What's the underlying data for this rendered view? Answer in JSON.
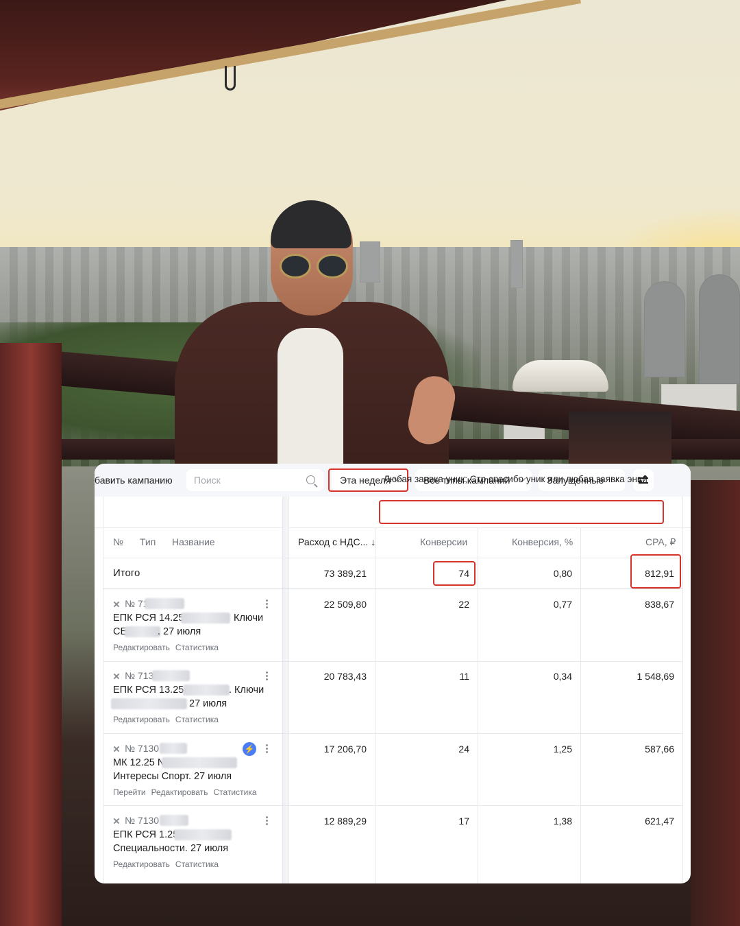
{
  "toolbar": {
    "add_campaign": "бавить кампанию",
    "search_placeholder": "Поиск",
    "period": "Эта неделя",
    "campaign_types": "Все типы кампаний",
    "status_filter": "Запущенные"
  },
  "goal_filter": "Любая заявка уник; Стр спасибо уник или любая заявка энви",
  "columns": {
    "number": "№",
    "type": "Тип",
    "name": "Название",
    "spend": "Расход с НДС... ↓",
    "conversions": "Конверсии",
    "conversion_rate": "Конверсия, %",
    "cpa": "CPA, ₽"
  },
  "totals": {
    "label": "Итого",
    "spend": "73 389,21",
    "conversions": "74",
    "conversion_rate": "0,80",
    "cpa": "812,91"
  },
  "campaigns": [
    {
      "id": "№ 71",
      "line1": "ЕПК РСЯ 14.25",
      "line1_tail": "Ключи",
      "line2_head": "СЕ",
      "line2_tail": ". 27 июля",
      "actions": [
        "Редактировать",
        "Статистика"
      ],
      "spend": "22 509,80",
      "conversions": "22",
      "conversion_rate": "0,77",
      "cpa": "838,67"
    },
    {
      "id": "№ 713",
      "line1": "ЕПК РСЯ 13.25 І",
      "line1_tail": ". Ключи",
      "line2_tail": "27 июля",
      "actions": [
        "Редактировать",
        "Статистика"
      ],
      "spend": "20 783,43",
      "conversions": "11",
      "conversion_rate": "0,34",
      "cpa": "1 548,69"
    },
    {
      "id": "№ 7130",
      "line1": "МК 12.25 N",
      "line2": "Интересы Спорт. 27 июля",
      "actions": [
        "Перейти",
        "Редактировать",
        "Статистика"
      ],
      "spend": "17 206,70",
      "conversions": "24",
      "conversion_rate": "1,25",
      "cpa": "587,66"
    },
    {
      "id": "№ 7130",
      "line1": "ЕПК РСЯ 1.25",
      "line2": "Специальности. 27 июля",
      "actions": [
        "Редактировать",
        "Статистика"
      ],
      "spend": "12 889,29",
      "conversions": "17",
      "conversion_rate": "1,38",
      "cpa": "621,47"
    }
  ],
  "colors": {
    "highlight": "#d6332b",
    "accent": "#4a7cf7",
    "toolbar_bg": "#f4f6fa"
  },
  "icons": [
    "search-icon",
    "chevron-down-icon",
    "settings-sliders-icon",
    "status-paused-icon",
    "lightning-icon",
    "more-vertical-icon"
  ]
}
